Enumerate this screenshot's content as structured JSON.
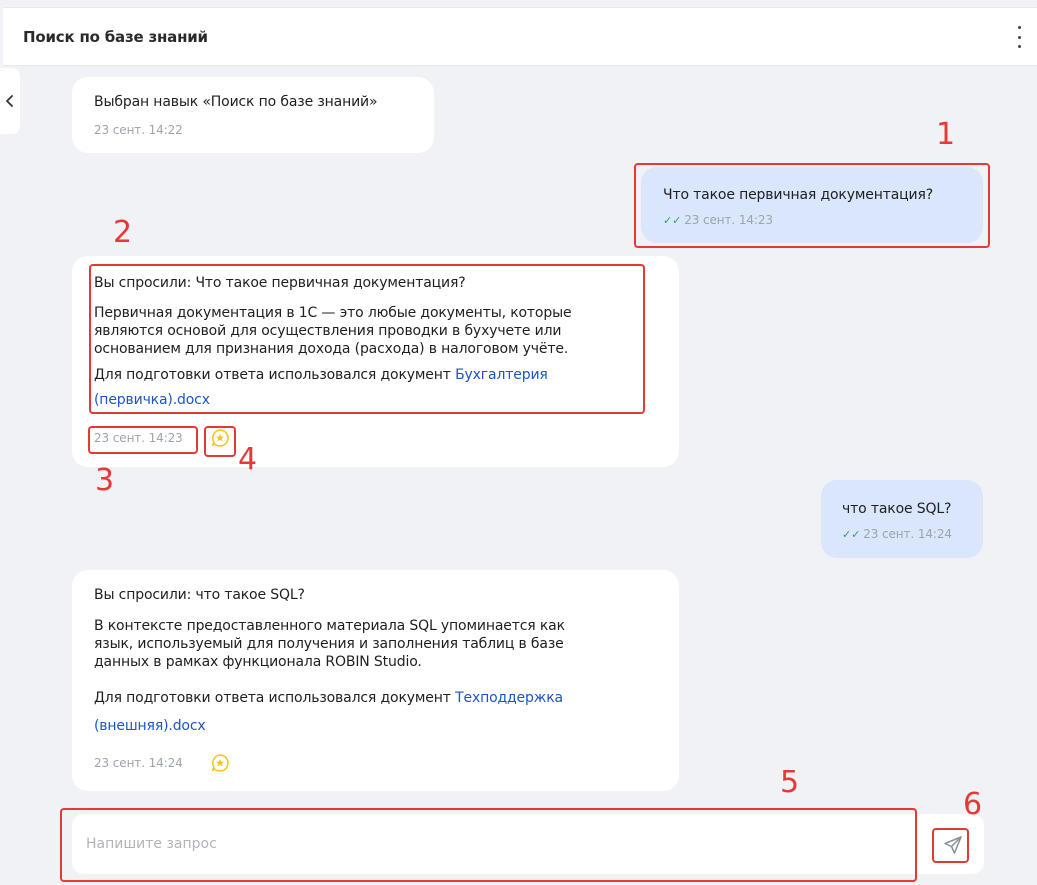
{
  "header": {
    "title": "Поиск по базе знаний"
  },
  "messages": [
    {
      "text": "Выбран навык «Поиск по базе знаний»",
      "time": "23 сент. 14:22"
    },
    {
      "text": "Что такое первичная документация?",
      "time": "23 сент. 14:23"
    },
    {
      "question": "Вы спросили: Что такое первичная документация?",
      "lines": [
        "Первичная документация в 1С — это любые документы, которые",
        "являются основой для осуществления проводки в бухучете или",
        "основанием для признания дохода (расхода) в налоговом учёте."
      ],
      "source_prefix": "Для подготовки ответа использовался документ",
      "source_link_1": "Бухгалтерия",
      "source_link_2": "(первичка).docx",
      "time": "23 сент. 14:23"
    },
    {
      "text": "что такое SQL?",
      "time": "23 сент. 14:24"
    },
    {
      "question": "Вы спросили: что такое SQL?",
      "lines": [
        "В контексте предоставленного материала SQL упоминается как",
        "язык, используемый для получения и заполнения таблиц в базе",
        "данных в рамках функционала ROBIN Studio."
      ],
      "source_prefix": "Для подготовки ответа использовался документ",
      "source_link_1": "Техподдержка",
      "source_link_2": "(внешняя).docx",
      "time": "23 сент. 14:24"
    }
  ],
  "input": {
    "placeholder": "Напишите запрос",
    "value": ""
  },
  "annotations": [
    "1",
    "2",
    "3",
    "4",
    "5",
    "6"
  ],
  "colors": {
    "background": "#f1f2f5",
    "user_bubble": "#d9e6fb",
    "bot_bubble": "#ffffff",
    "link": "#1d55c4",
    "read_check": "#29a36a",
    "annotation": "#e53935",
    "star": "#f5c518"
  }
}
